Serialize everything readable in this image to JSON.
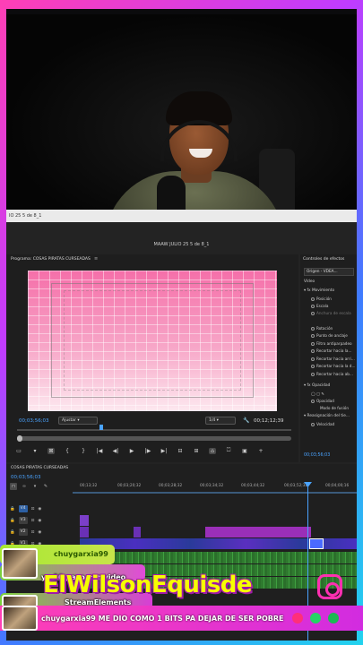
{
  "webcam": {
    "caption": "IO 25 5 de 8_1"
  },
  "editor": {
    "window_title": "MAAW JULIO 25 5 de 8_1",
    "program": {
      "tab_label": "Programa: COSAS PIRATAS CURSEADAS",
      "menu_glyph": "≡",
      "timecode_left": "00;03;56;03",
      "fit": "Ajustar",
      "resolution": "1/4",
      "timecode_right": "00;12;12;39",
      "transport": [
        "▭",
        "▾",
        "⊠",
        "{",
        "}",
        "|◀",
        "◀|",
        "▶",
        "|▶",
        "▶|",
        "⊟",
        "⊞",
        "⌂",
        "⏍",
        "▣",
        "+"
      ]
    },
    "effects": {
      "tab_label": "Controles de efectos",
      "source": "Origen - VDEA...",
      "video_label": "Vídeo",
      "motion_label": "Movimiento",
      "rows": [
        "Posición",
        "Escala",
        "Anchura de escala",
        "Rotación",
        "Punto de anclaje",
        "Filtro antiparpadeo",
        "Recortar hacia la...",
        "Recortar hacia arri...",
        "Recortar hacia la d...",
        "Recortar hacia ab..."
      ],
      "opacity_label": "Opacidad",
      "opacity_rows": [
        "Opacidad",
        "Modo de fusión"
      ],
      "remap_label": "Reasignación del tie...",
      "speed_row": "Velocidad",
      "timecode": "00;03;56;03"
    },
    "timeline": {
      "tab_label": "COSAS PIRATAS CURSEADAS",
      "timecode": "00;03;56;03",
      "ruler": [
        "00;13;32",
        "00;03;20;32",
        "00;03;28;32",
        "00;03;34;32",
        "00;03;44;32",
        "00;03;52;32",
        "00;04;00;16"
      ],
      "tracks": [
        "V4",
        "V3",
        "V2",
        "V1"
      ]
    }
  },
  "overlays": {
    "chat1_user": "chuygarxia99",
    "chat2_text": "yo 10 paso por video",
    "chat3_user": "StreamElements",
    "handle": "ElWilsonEquisde",
    "bottom_message": "chuygarxia99 ME DIO COMO 1 BITS PA DEJAR DE SER POBRE"
  },
  "colors": {
    "accent_blue": "#4aa3ff",
    "handle_yellow": "#f6ff00",
    "brand_pink": "#ff3fb5"
  }
}
